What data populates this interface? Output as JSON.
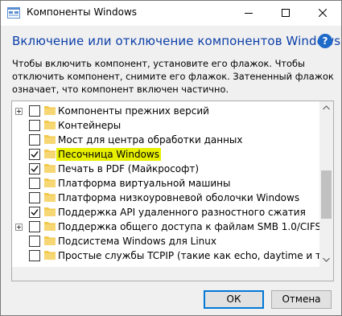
{
  "window": {
    "title": "Компоненты Windows",
    "controls": [
      "minimize",
      "maximize",
      "close"
    ]
  },
  "header": {
    "heading": "Включение или отключение компонентов Windows",
    "help": "?"
  },
  "description": "Чтобы включить компонент, установите его флажок. Чтобы отключить компонент, снимите его флажок. Затененный флажок означает, что компонент включен частично.",
  "features": [
    {
      "label": "Компоненты прежних версий",
      "checked": false,
      "expandable": true,
      "highlighted": false
    },
    {
      "label": "Контейнеры",
      "checked": false,
      "expandable": false,
      "highlighted": false
    },
    {
      "label": "Мост для центра обработки данных",
      "checked": false,
      "expandable": false,
      "highlighted": false
    },
    {
      "label": "Песочница Windows",
      "checked": true,
      "expandable": false,
      "highlighted": true
    },
    {
      "label": "Печать в PDF (Майкрософт)",
      "checked": true,
      "expandable": false,
      "highlighted": false
    },
    {
      "label": "Платформа виртуальной машины",
      "checked": false,
      "expandable": false,
      "highlighted": false
    },
    {
      "label": "Платформа низкоуровневой оболочки Windows",
      "checked": false,
      "expandable": false,
      "highlighted": false
    },
    {
      "label": "Поддержка API удаленного разностного сжатия",
      "checked": true,
      "expandable": false,
      "highlighted": false
    },
    {
      "label": "Поддержка общего доступа к файлам SMB 1.0/CIFS",
      "checked": false,
      "expandable": true,
      "highlighted": false
    },
    {
      "label": "Подсистема Windows для Linux",
      "checked": false,
      "expandable": false,
      "highlighted": false
    },
    {
      "label": "Простые службы TCPIP (такие как echo, daytime и т.п.)",
      "checked": false,
      "expandable": false,
      "highlighted": false
    }
  ],
  "buttons": {
    "ok": "ОК",
    "cancel": "Отмена"
  },
  "colors": {
    "heading": "#0b3ea8",
    "highlight": "#e8f000",
    "folder": "#f2c94c",
    "accent": "#0078d7"
  }
}
